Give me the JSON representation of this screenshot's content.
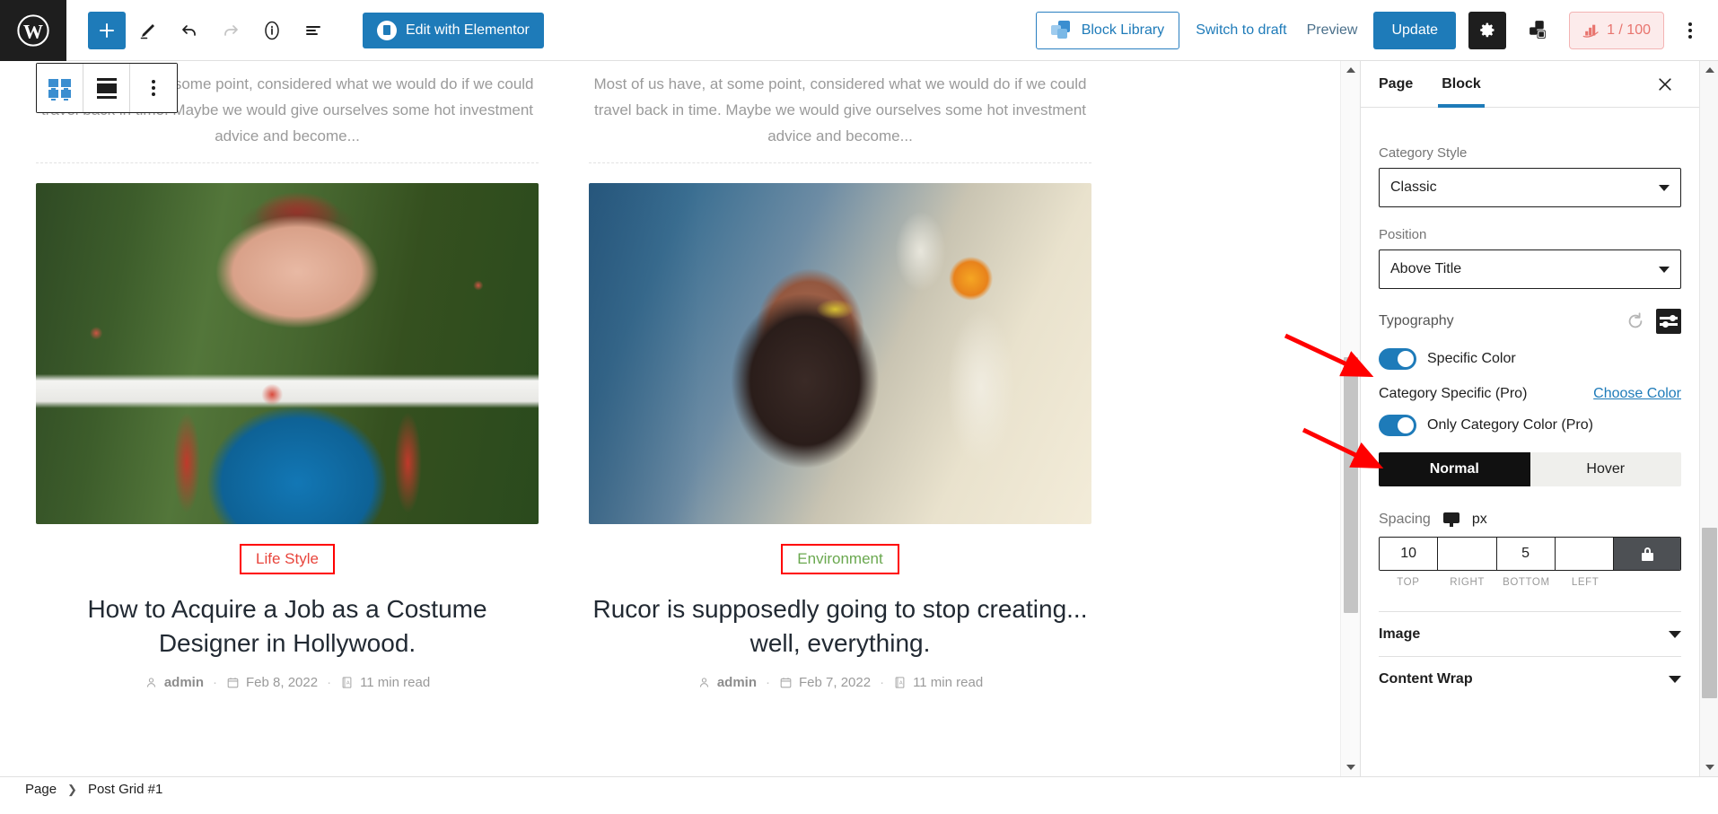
{
  "topbar": {
    "logo_icon": "wordpress-logo-icon",
    "buttons": [
      {
        "name": "add-block-button",
        "icon": "plus-icon"
      },
      {
        "name": "edit-tools-button",
        "icon": "pencil-icon"
      },
      {
        "name": "undo-button",
        "icon": "undo-arrow-icon"
      },
      {
        "name": "redo-button",
        "icon": "redo-arrow-icon"
      },
      {
        "name": "details-button",
        "icon": "info-circle-icon"
      },
      {
        "name": "list-view-button",
        "icon": "list-view-icon"
      }
    ],
    "elementor_label": "Edit with Elementor",
    "block_library_label": "Block Library",
    "switch_to_draft_label": "Switch to draft",
    "preview_label": "Preview",
    "update_label": "Update",
    "settings_icon": "gear-icon",
    "blocks_icon": "blocks-stack-icon",
    "score_icon": "seo-score-icon",
    "score_label": "1 / 100",
    "more_icon": "vertical-ellipsis-icon"
  },
  "block_toolbar": {
    "grid_icon": "post-grid-block-icon",
    "align_icon": "align-wide-icon",
    "options_icon": "more-options-ellipsis-icon"
  },
  "canvas": {
    "excerpt_left": "Most of us have, at some point, considered what we would do if we could travel back in time. Maybe we would give ourselves some hot investment advice and become...",
    "excerpt_right": "Most of us have, at some point, considered what we would do if we could travel back in time. Maybe we would give ourselves some hot investment advice and become...",
    "cards": [
      {
        "category": "Life Style",
        "category_color": "#e8453c",
        "title": "How to Acquire a Job as a Costume Designer in Hollywood.",
        "author": "admin",
        "date": "Feb 8, 2022",
        "read_time": "11 min read",
        "image_alt": "woman-in-snow-white-costume"
      },
      {
        "category": "Environment",
        "category_color": "#6aa84f",
        "title": "Rucor is supposedly going to stop creating... well, everything.",
        "author": "admin",
        "date": "Feb 7, 2022",
        "read_time": "11 min read",
        "image_alt": "scientist-holding-flask"
      }
    ],
    "meta_separator": "·"
  },
  "sidebar": {
    "tabs": [
      {
        "label": "Page",
        "active": false
      },
      {
        "label": "Block",
        "active": true
      }
    ],
    "close_icon": "close-x-icon",
    "category_style": {
      "label": "Category Style",
      "value": "Classic"
    },
    "position": {
      "label": "Position",
      "value": "Above Title"
    },
    "typography": {
      "label": "Typography",
      "reset_icon": "reset-circular-arrow-icon",
      "settings_icon": "sliders-icon"
    },
    "specific_color": {
      "label": "Specific Color",
      "on": true
    },
    "category_specific": {
      "label": "Category Specific (Pro)",
      "link": "Choose Color"
    },
    "only_category_color": {
      "label": "Only Category Color (Pro)",
      "on": true
    },
    "state_tabs": [
      {
        "label": "Normal",
        "active": true
      },
      {
        "label": "Hover",
        "active": false
      }
    ],
    "spacing": {
      "label": "Spacing",
      "device_icon": "desktop-monitor-icon",
      "unit": "px",
      "values": {
        "top": "10",
        "right": "",
        "bottom": "5",
        "left": ""
      },
      "field_labels": [
        "TOP",
        "RIGHT",
        "BOTTOM",
        "LEFT"
      ],
      "lock_icon": "lock-icon"
    },
    "accordions": [
      {
        "label": "Image",
        "icon": "chevron-down-icon"
      },
      {
        "label": "Content Wrap",
        "icon": "chevron-down-icon"
      }
    ]
  },
  "bottombar": {
    "breadcrumb": [
      "Page",
      "Post Grid #1"
    ],
    "separator_icon": "chevron-right-icon"
  },
  "annotations": {
    "arrow_color": "#ff0000",
    "arrows": [
      {
        "name": "arrow-to-specific-color-toggle"
      },
      {
        "name": "arrow-to-only-category-color-toggle"
      }
    ]
  }
}
